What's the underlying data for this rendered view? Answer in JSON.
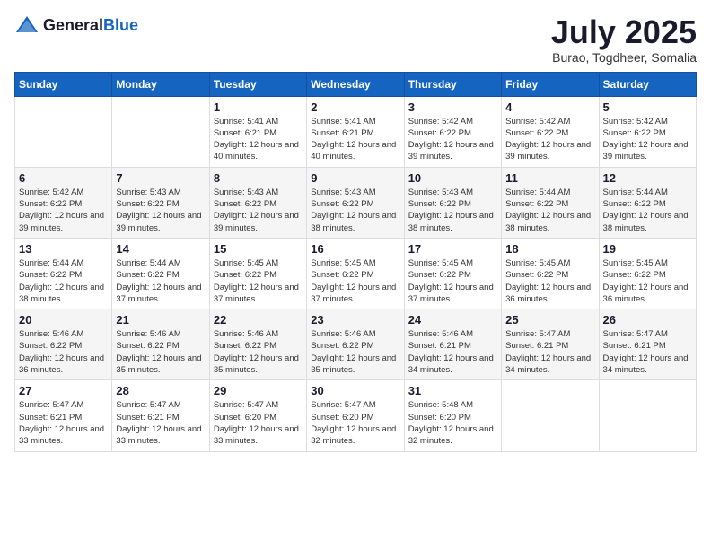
{
  "header": {
    "logo": {
      "general": "General",
      "blue": "Blue"
    },
    "title": "July 2025",
    "location": "Burao, Togdheer, Somalia"
  },
  "weekdays": [
    "Sunday",
    "Monday",
    "Tuesday",
    "Wednesday",
    "Thursday",
    "Friday",
    "Saturday"
  ],
  "weeks": [
    [
      {
        "day": "",
        "info": ""
      },
      {
        "day": "",
        "info": ""
      },
      {
        "day": "1",
        "info": "Sunrise: 5:41 AM\nSunset: 6:21 PM\nDaylight: 12 hours and 40 minutes."
      },
      {
        "day": "2",
        "info": "Sunrise: 5:41 AM\nSunset: 6:21 PM\nDaylight: 12 hours and 40 minutes."
      },
      {
        "day": "3",
        "info": "Sunrise: 5:42 AM\nSunset: 6:22 PM\nDaylight: 12 hours and 39 minutes."
      },
      {
        "day": "4",
        "info": "Sunrise: 5:42 AM\nSunset: 6:22 PM\nDaylight: 12 hours and 39 minutes."
      },
      {
        "day": "5",
        "info": "Sunrise: 5:42 AM\nSunset: 6:22 PM\nDaylight: 12 hours and 39 minutes."
      }
    ],
    [
      {
        "day": "6",
        "info": "Sunrise: 5:42 AM\nSunset: 6:22 PM\nDaylight: 12 hours and 39 minutes."
      },
      {
        "day": "7",
        "info": "Sunrise: 5:43 AM\nSunset: 6:22 PM\nDaylight: 12 hours and 39 minutes."
      },
      {
        "day": "8",
        "info": "Sunrise: 5:43 AM\nSunset: 6:22 PM\nDaylight: 12 hours and 39 minutes."
      },
      {
        "day": "9",
        "info": "Sunrise: 5:43 AM\nSunset: 6:22 PM\nDaylight: 12 hours and 38 minutes."
      },
      {
        "day": "10",
        "info": "Sunrise: 5:43 AM\nSunset: 6:22 PM\nDaylight: 12 hours and 38 minutes."
      },
      {
        "day": "11",
        "info": "Sunrise: 5:44 AM\nSunset: 6:22 PM\nDaylight: 12 hours and 38 minutes."
      },
      {
        "day": "12",
        "info": "Sunrise: 5:44 AM\nSunset: 6:22 PM\nDaylight: 12 hours and 38 minutes."
      }
    ],
    [
      {
        "day": "13",
        "info": "Sunrise: 5:44 AM\nSunset: 6:22 PM\nDaylight: 12 hours and 38 minutes."
      },
      {
        "day": "14",
        "info": "Sunrise: 5:44 AM\nSunset: 6:22 PM\nDaylight: 12 hours and 37 minutes."
      },
      {
        "day": "15",
        "info": "Sunrise: 5:45 AM\nSunset: 6:22 PM\nDaylight: 12 hours and 37 minutes."
      },
      {
        "day": "16",
        "info": "Sunrise: 5:45 AM\nSunset: 6:22 PM\nDaylight: 12 hours and 37 minutes."
      },
      {
        "day": "17",
        "info": "Sunrise: 5:45 AM\nSunset: 6:22 PM\nDaylight: 12 hours and 37 minutes."
      },
      {
        "day": "18",
        "info": "Sunrise: 5:45 AM\nSunset: 6:22 PM\nDaylight: 12 hours and 36 minutes."
      },
      {
        "day": "19",
        "info": "Sunrise: 5:45 AM\nSunset: 6:22 PM\nDaylight: 12 hours and 36 minutes."
      }
    ],
    [
      {
        "day": "20",
        "info": "Sunrise: 5:46 AM\nSunset: 6:22 PM\nDaylight: 12 hours and 36 minutes."
      },
      {
        "day": "21",
        "info": "Sunrise: 5:46 AM\nSunset: 6:22 PM\nDaylight: 12 hours and 35 minutes."
      },
      {
        "day": "22",
        "info": "Sunrise: 5:46 AM\nSunset: 6:22 PM\nDaylight: 12 hours and 35 minutes."
      },
      {
        "day": "23",
        "info": "Sunrise: 5:46 AM\nSunset: 6:22 PM\nDaylight: 12 hours and 35 minutes."
      },
      {
        "day": "24",
        "info": "Sunrise: 5:46 AM\nSunset: 6:21 PM\nDaylight: 12 hours and 34 minutes."
      },
      {
        "day": "25",
        "info": "Sunrise: 5:47 AM\nSunset: 6:21 PM\nDaylight: 12 hours and 34 minutes."
      },
      {
        "day": "26",
        "info": "Sunrise: 5:47 AM\nSunset: 6:21 PM\nDaylight: 12 hours and 34 minutes."
      }
    ],
    [
      {
        "day": "27",
        "info": "Sunrise: 5:47 AM\nSunset: 6:21 PM\nDaylight: 12 hours and 33 minutes."
      },
      {
        "day": "28",
        "info": "Sunrise: 5:47 AM\nSunset: 6:21 PM\nDaylight: 12 hours and 33 minutes."
      },
      {
        "day": "29",
        "info": "Sunrise: 5:47 AM\nSunset: 6:20 PM\nDaylight: 12 hours and 33 minutes."
      },
      {
        "day": "30",
        "info": "Sunrise: 5:47 AM\nSunset: 6:20 PM\nDaylight: 12 hours and 32 minutes."
      },
      {
        "day": "31",
        "info": "Sunrise: 5:48 AM\nSunset: 6:20 PM\nDaylight: 12 hours and 32 minutes."
      },
      {
        "day": "",
        "info": ""
      },
      {
        "day": "",
        "info": ""
      }
    ]
  ]
}
